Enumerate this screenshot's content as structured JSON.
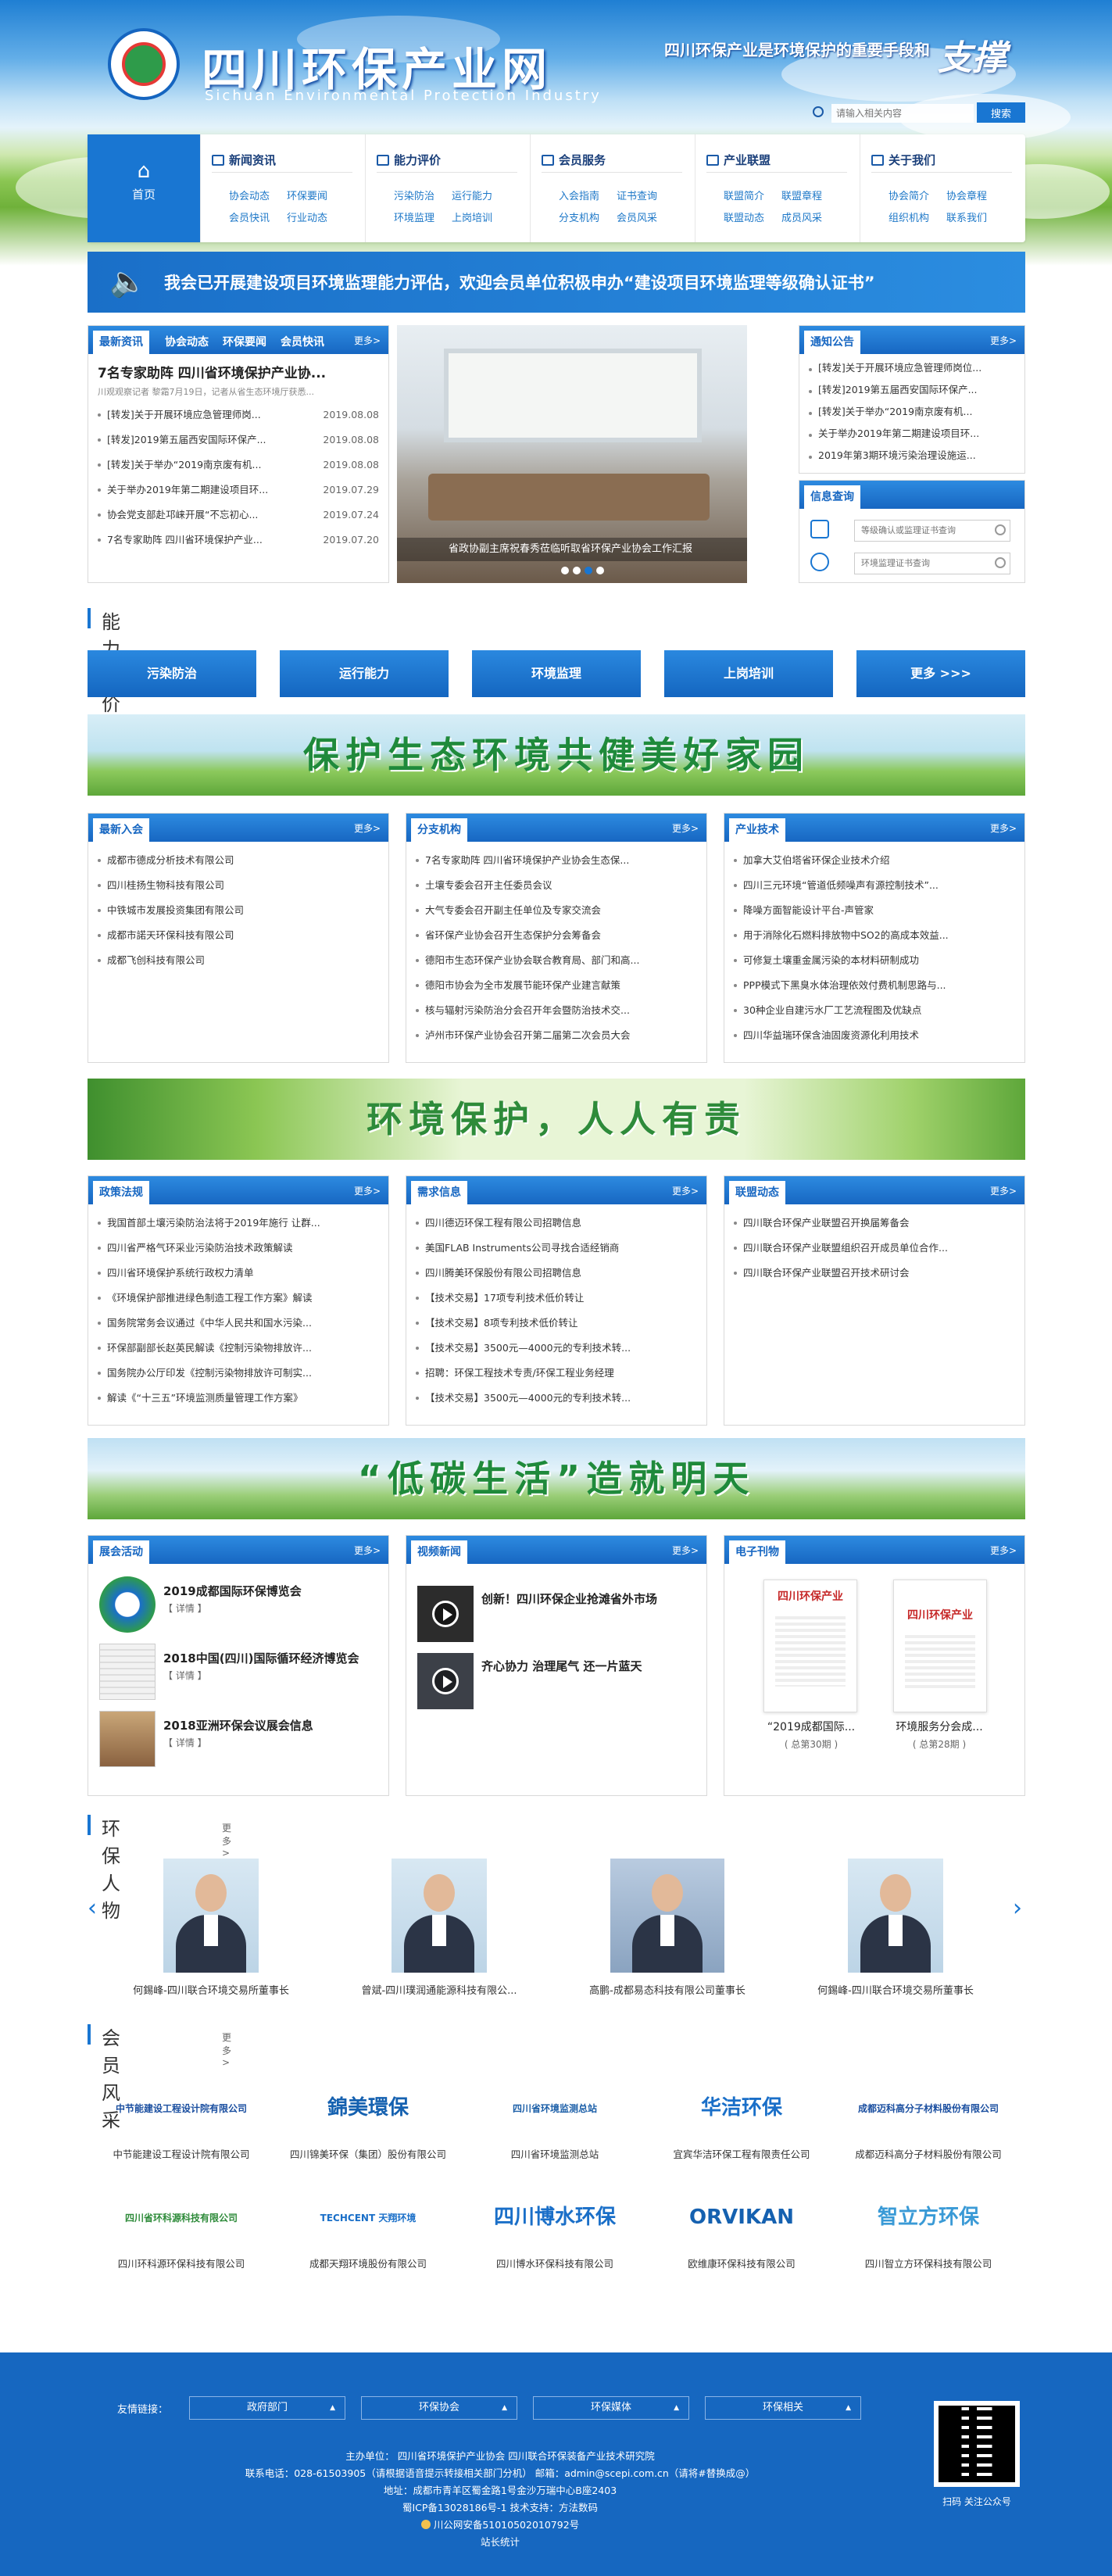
{
  "header": {
    "site_name": "四川环保产业网",
    "site_name_en": "Sichuan Environmental Protection Industry",
    "slogan": "四川环保产业是环境保护的重要手段和",
    "slogan_script": "支撑",
    "search_placeholder": "请输入相关内容",
    "search_button": "搜索"
  },
  "nav": {
    "home": "首页",
    "cols": [
      {
        "title": "新闻资讯",
        "items": [
          "协会动态",
          "环保要闻",
          "会员快讯",
          "行业动态"
        ]
      },
      {
        "title": "能力评价",
        "items": [
          "污染防治",
          "运行能力",
          "环境监理",
          "上岗培训"
        ]
      },
      {
        "title": "会员服务",
        "items": [
          "入会指南",
          "证书查询",
          "分支机构",
          "会员风采"
        ]
      },
      {
        "title": "产业联盟",
        "items": [
          "联盟简介",
          "联盟章程",
          "联盟动态",
          "成员风采"
        ]
      },
      {
        "title": "关于我们",
        "items": [
          "协会简介",
          "协会章程",
          "组织机构",
          "联系我们"
        ]
      }
    ]
  },
  "notice": "我会已开展建设项目环境监理能力评估，欢迎会员单位积极申办“建设项目环境监理等级确认证书”",
  "news": {
    "tabs": [
      "最新资讯",
      "协会动态",
      "环保要闻",
      "会员快讯"
    ],
    "more": "更多>",
    "headline": "7名专家助阵 四川省环境保护产业协...",
    "summary": "川观观察记者 黎霜7月19日，记者从省生态环境厅获悉...",
    "items": [
      {
        "t": "[转发]关于开展环境应急管理师岗...",
        "d": "2019.08.08"
      },
      {
        "t": "[转发]2019第五届西安国际环保产...",
        "d": "2019.08.08"
      },
      {
        "t": "[转发]关于举办“2019南京废有机...",
        "d": "2019.08.08"
      },
      {
        "t": "关于举办2019年第二期建设项目环...",
        "d": "2019.07.29"
      },
      {
        "t": "协会党支部赴邛崃开展“不忘初心...",
        "d": "2019.07.24"
      },
      {
        "t": "7名专家助阵 四川省环境保护产业...",
        "d": "2019.07.20"
      }
    ]
  },
  "slide_caption": "省政协副主席祝春秀莅临听取省环保产业协会工作汇报",
  "notices": {
    "title": "通知公告",
    "more": "更多>",
    "items": [
      "[转发]关于开展环境应急管理师岗位...",
      "[转发]2019第五届西安国际环保产...",
      "[转发]关于举办“2019南京废有机...",
      "关于举办2019年第二期建设项目环...",
      "2019年第3期环境污染治理设施运..."
    ]
  },
  "info_query": {
    "title": "信息查询",
    "q1_placeholder": "等级确认或监理证书查询",
    "q2_placeholder": "环境监理证书查询"
  },
  "ability": {
    "title": "能力评价",
    "buttons": [
      "污染防治",
      "运行能力",
      "环境监理",
      "上岗培训",
      "更多 >>>"
    ]
  },
  "banner1": "保护生态环境共健美好家园",
  "banner2": "环境保护，人人有责",
  "banner3": "“低碳生活”造就明天",
  "row1": [
    {
      "title": "最新入会",
      "more": "更多>",
      "items": [
        "成都市德成分析技术有限公司",
        "四川桂扬生物科技有限公司",
        "中铁城市发展投资集团有限公司",
        "成都市諾天环保科技有限公司",
        "成都飞创科技有限公司"
      ]
    },
    {
      "title": "分支机构",
      "more": "更多>",
      "items": [
        "7名专家助阵 四川省环境保护产业协会生态保...",
        "土壤专委会召开主任委员会议",
        "大气专委会召开副主任单位及专家交流会",
        "省环保产业协会召开生态保护分会筹备会",
        "德阳市生态环保产业协会联合教育局、部门和高...",
        "德阳市协会为全市发展节能环保产业建言献策",
        "核与辐射污染防治分会召开年会暨防治技术交...",
        "泸州市环保产业协会召开第二届第二次会员大会"
      ]
    },
    {
      "title": "产业技术",
      "more": "更多>",
      "items": [
        "加拿大艾伯塔省环保企业技术介绍",
        "四川三元环境“管道低频噪声有源控制技术”...",
        "降噪方面智能设计平台-声管家",
        "用于消除化石燃料排放物中SO2的高成本效益...",
        "可修复土壤重金属污染的本材料研制成功",
        "PPP模式下黑臭水体治理依效付费机制思路与...",
        "30种企业自建污水厂工艺流程图及优缺点",
        "四川华益瑞环保含油固废资源化利用技术"
      ]
    }
  ],
  "row2": [
    {
      "title": "政策法规",
      "more": "更多>",
      "items": [
        "我国首部土壤污染防治法将于2019年施行 让群...",
        "四川省严格气环采业污染防治技术政策解读",
        "四川省环境保护系统行政权力清单",
        "《环境保护部推进绿色制造工程工作方案》解读",
        "国务院常务会议通过《中华人民共和国水污染...",
        "环保部副部长赵英民解读《控制污染物排放许...",
        "国务院办公厅印发《控制污染物排放许可制实...",
        "解读《“十三五”环境监测质量管理工作方案》"
      ]
    },
    {
      "title": "需求信息",
      "more": "更多>",
      "items": [
        "四川德迈环保工程有限公司招聘信息",
        "美国FLAB Instruments公司寻找合适经销商",
        "四川腾美环保股份有限公司招聘信息",
        "【技术交易】17项专利技术低价转让",
        "【技术交易】8项专利技术低价转让",
        "【技术交易】3500元—4000元的专利技术转...",
        "招聘：环保工程技术专责/环保工程业务经理",
        "【技术交易】3500元—4000元的专利技术转..."
      ]
    },
    {
      "title": "联盟动态",
      "more": "更多>",
      "items": [
        "四川联合环保产业联盟召开换届筹备会",
        "四川联合环保产业联盟组织召开成员单位合作...",
        "四川联合环保产业联盟召开技术研讨会"
      ]
    }
  ],
  "row3": {
    "expo": {
      "title": "展会活动",
      "more": "更多>",
      "items": [
        {
          "t": "2019成都国际环保博览会",
          "s": "【 详情 】"
        },
        {
          "t": "2018中国(四川)国际循环经济博览会",
          "s": "【 详情 】"
        },
        {
          "t": "2018亚洲环保会议展会信息",
          "s": "【 详情 】"
        }
      ]
    },
    "video": {
      "title": "视频新闻",
      "more": "更多>",
      "items": [
        "创新！四川环保企业抢滩省外市场",
        "齐心协力 治理尾气 还一片蓝天"
      ]
    },
    "mag": {
      "title": "电子刊物",
      "more": "更多>",
      "items": [
        {
          "t": "“2019成都国际...",
          "n": "( 总第30期 )",
          "cover": "四川环保产业"
        },
        {
          "t": "环境服务分会成...",
          "n": "( 总第28期 )",
          "cover": "四川环保产业"
        }
      ]
    }
  },
  "people": {
    "title": "环保人物",
    "more": "更多 >",
    "items": [
      "何錫峰-四川联合环境交易所董事长",
      "曾斌-四川璞润通能源科技有限公...",
      "高鹏-成都易态科技有限公司董事长",
      "何錫峰-四川联合环境交易所董事长"
    ]
  },
  "members": {
    "title": "会员风采",
    "more": "更多 >",
    "items": [
      {
        "name": "中节能建设工程设计院有限公司",
        "logo": "中节能建设工程设计院有限公司",
        "color": "#1b4fa0"
      },
      {
        "name": "四川锦美环保（集团）股份有限公司",
        "logo": "錦美環保",
        "color": "#1561b0"
      },
      {
        "name": "四川省环境监测总站",
        "logo": "四川省环境监测总站",
        "color": "#1c5fa8"
      },
      {
        "name": "宜宾华洁环保工程有限责任公司",
        "logo": "华洁环保",
        "color": "#1a6fc8"
      },
      {
        "name": "成都迈科高分子材料股份有限公司",
        "logo": "成都迈科高分子材料股份有限公司",
        "color": "#1b4fa0"
      },
      {
        "name": "四川环科源环保科技有限公司",
        "logo": "四川省环科源科技有限公司",
        "color": "#2e8b3a"
      },
      {
        "name": "成都天翔环境股份有限公司",
        "logo": "TECHCENT 天翔环境",
        "color": "#1a6fc8"
      },
      {
        "name": "四川博水环保科技有限公司",
        "logo": "四川博水环保",
        "color": "#1a6fc8"
      },
      {
        "name": "欧维康环保科技有限公司",
        "logo": "ORVIKAN",
        "color": "#1561b0"
      },
      {
        "name": "四川智立方环保科技有限公司",
        "logo": "智立方环保",
        "color": "#3a9ad6"
      }
    ]
  },
  "footer": {
    "links_label": "友情链接：",
    "selects": [
      "政府部门",
      "环保协会",
      "环保媒体",
      "环保相关"
    ],
    "lines": [
      "主办单位： 四川省环境保护产业协会 四川联合环保装备产业技术研究院",
      "联系电话：028-61503905（请根据语音提示转接相关部门分机）    邮箱：admin@scepi.com.cn（请将#替换成@）",
      "地址：成都市青羊区蜀金路1号金沙万瑞中心B座2403",
      "蜀ICP备13028186号-1    技术支持：方法数码",
      "川公网安备51010502010792号",
      "站长统计"
    ],
    "qr_label": "扫码 关注公众号"
  }
}
